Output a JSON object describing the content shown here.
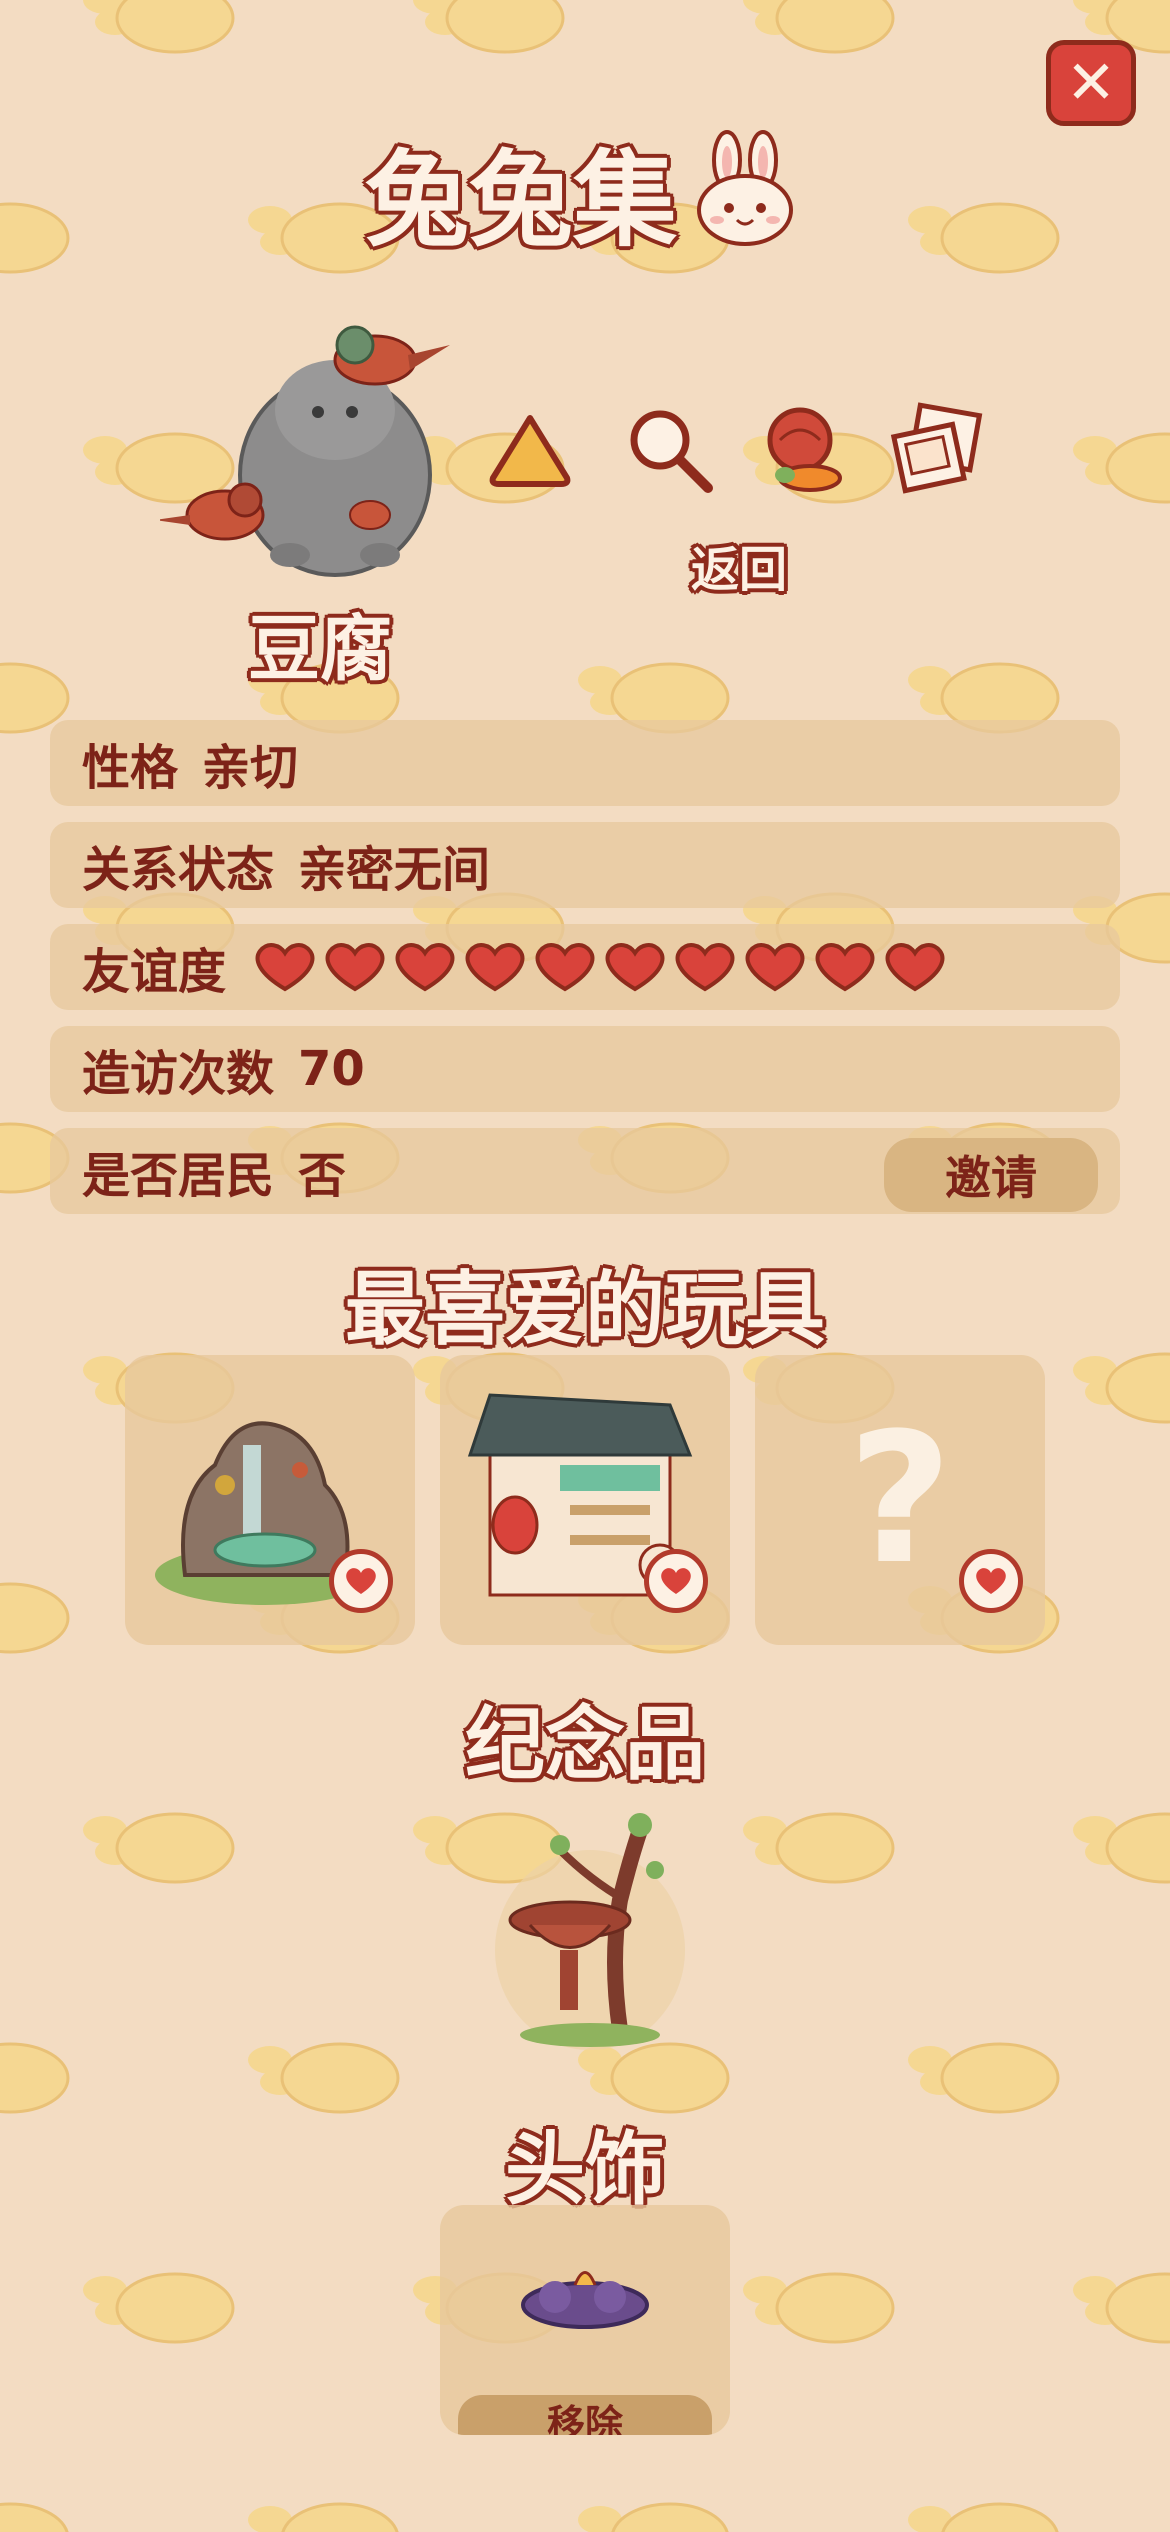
{
  "header": {
    "title": "兔兔集",
    "close_icon": "close-x-icon"
  },
  "nav": {
    "back_label": "返回",
    "icons": [
      "triangle-rice-icon",
      "magnifier-icon",
      "food-basket-icon",
      "photo-frame-icon"
    ]
  },
  "character": {
    "name": "豆腐"
  },
  "info": {
    "personality_label": "性格",
    "personality_value": "亲切",
    "relationship_label": "关系状态",
    "relationship_value": "亲密无间",
    "friendship_label": "友谊度",
    "friendship_hearts": 10,
    "visits_label": "造访次数",
    "visits_value": "70",
    "resident_label": "是否居民",
    "resident_value": "否",
    "invite_label": "邀请"
  },
  "toys": {
    "title": "最喜爱的玩具",
    "items": [
      {
        "icon": "rock-fountain-icon"
      },
      {
        "icon": "stall-shop-icon"
      },
      {
        "icon": "unknown-question-icon",
        "label": "?"
      }
    ]
  },
  "souvenir": {
    "title": "纪念品",
    "icon": "tree-birdbath-icon"
  },
  "headwear": {
    "title": "头饰",
    "icon": "cloud-hat-icon",
    "remove_label": "移除"
  },
  "colors": {
    "background": "#f3dcc2",
    "row": "#e7c89c",
    "accent_red": "#d9433b",
    "outline_red": "#8e2b1c",
    "carrot": "#f6d78a"
  }
}
